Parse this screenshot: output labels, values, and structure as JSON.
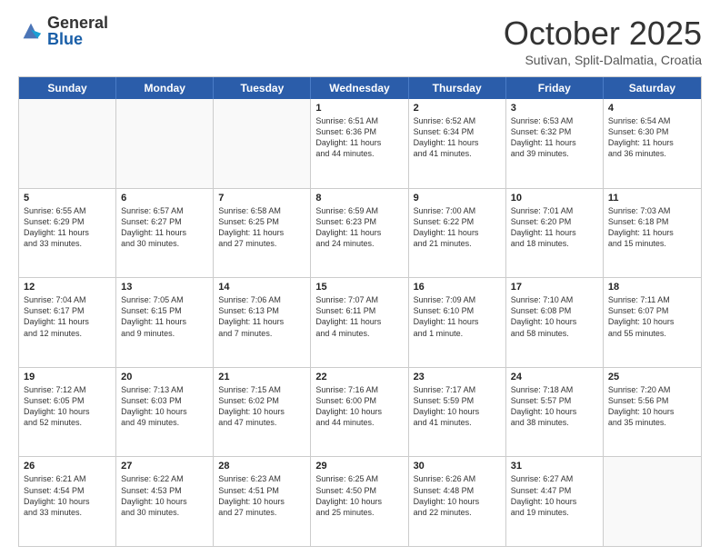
{
  "header": {
    "logo_general": "General",
    "logo_blue": "Blue",
    "month_title": "October 2025",
    "subtitle": "Sutivan, Split-Dalmatia, Croatia"
  },
  "weekdays": [
    "Sunday",
    "Monday",
    "Tuesday",
    "Wednesday",
    "Thursday",
    "Friday",
    "Saturday"
  ],
  "rows": [
    [
      {
        "day": "",
        "info": ""
      },
      {
        "day": "",
        "info": ""
      },
      {
        "day": "",
        "info": ""
      },
      {
        "day": "1",
        "info": "Sunrise: 6:51 AM\nSunset: 6:36 PM\nDaylight: 11 hours\nand 44 minutes."
      },
      {
        "day": "2",
        "info": "Sunrise: 6:52 AM\nSunset: 6:34 PM\nDaylight: 11 hours\nand 41 minutes."
      },
      {
        "day": "3",
        "info": "Sunrise: 6:53 AM\nSunset: 6:32 PM\nDaylight: 11 hours\nand 39 minutes."
      },
      {
        "day": "4",
        "info": "Sunrise: 6:54 AM\nSunset: 6:30 PM\nDaylight: 11 hours\nand 36 minutes."
      }
    ],
    [
      {
        "day": "5",
        "info": "Sunrise: 6:55 AM\nSunset: 6:29 PM\nDaylight: 11 hours\nand 33 minutes."
      },
      {
        "day": "6",
        "info": "Sunrise: 6:57 AM\nSunset: 6:27 PM\nDaylight: 11 hours\nand 30 minutes."
      },
      {
        "day": "7",
        "info": "Sunrise: 6:58 AM\nSunset: 6:25 PM\nDaylight: 11 hours\nand 27 minutes."
      },
      {
        "day": "8",
        "info": "Sunrise: 6:59 AM\nSunset: 6:23 PM\nDaylight: 11 hours\nand 24 minutes."
      },
      {
        "day": "9",
        "info": "Sunrise: 7:00 AM\nSunset: 6:22 PM\nDaylight: 11 hours\nand 21 minutes."
      },
      {
        "day": "10",
        "info": "Sunrise: 7:01 AM\nSunset: 6:20 PM\nDaylight: 11 hours\nand 18 minutes."
      },
      {
        "day": "11",
        "info": "Sunrise: 7:03 AM\nSunset: 6:18 PM\nDaylight: 11 hours\nand 15 minutes."
      }
    ],
    [
      {
        "day": "12",
        "info": "Sunrise: 7:04 AM\nSunset: 6:17 PM\nDaylight: 11 hours\nand 12 minutes."
      },
      {
        "day": "13",
        "info": "Sunrise: 7:05 AM\nSunset: 6:15 PM\nDaylight: 11 hours\nand 9 minutes."
      },
      {
        "day": "14",
        "info": "Sunrise: 7:06 AM\nSunset: 6:13 PM\nDaylight: 11 hours\nand 7 minutes."
      },
      {
        "day": "15",
        "info": "Sunrise: 7:07 AM\nSunset: 6:11 PM\nDaylight: 11 hours\nand 4 minutes."
      },
      {
        "day": "16",
        "info": "Sunrise: 7:09 AM\nSunset: 6:10 PM\nDaylight: 11 hours\nand 1 minute."
      },
      {
        "day": "17",
        "info": "Sunrise: 7:10 AM\nSunset: 6:08 PM\nDaylight: 10 hours\nand 58 minutes."
      },
      {
        "day": "18",
        "info": "Sunrise: 7:11 AM\nSunset: 6:07 PM\nDaylight: 10 hours\nand 55 minutes."
      }
    ],
    [
      {
        "day": "19",
        "info": "Sunrise: 7:12 AM\nSunset: 6:05 PM\nDaylight: 10 hours\nand 52 minutes."
      },
      {
        "day": "20",
        "info": "Sunrise: 7:13 AM\nSunset: 6:03 PM\nDaylight: 10 hours\nand 49 minutes."
      },
      {
        "day": "21",
        "info": "Sunrise: 7:15 AM\nSunset: 6:02 PM\nDaylight: 10 hours\nand 47 minutes."
      },
      {
        "day": "22",
        "info": "Sunrise: 7:16 AM\nSunset: 6:00 PM\nDaylight: 10 hours\nand 44 minutes."
      },
      {
        "day": "23",
        "info": "Sunrise: 7:17 AM\nSunset: 5:59 PM\nDaylight: 10 hours\nand 41 minutes."
      },
      {
        "day": "24",
        "info": "Sunrise: 7:18 AM\nSunset: 5:57 PM\nDaylight: 10 hours\nand 38 minutes."
      },
      {
        "day": "25",
        "info": "Sunrise: 7:20 AM\nSunset: 5:56 PM\nDaylight: 10 hours\nand 35 minutes."
      }
    ],
    [
      {
        "day": "26",
        "info": "Sunrise: 6:21 AM\nSunset: 4:54 PM\nDaylight: 10 hours\nand 33 minutes."
      },
      {
        "day": "27",
        "info": "Sunrise: 6:22 AM\nSunset: 4:53 PM\nDaylight: 10 hours\nand 30 minutes."
      },
      {
        "day": "28",
        "info": "Sunrise: 6:23 AM\nSunset: 4:51 PM\nDaylight: 10 hours\nand 27 minutes."
      },
      {
        "day": "29",
        "info": "Sunrise: 6:25 AM\nSunset: 4:50 PM\nDaylight: 10 hours\nand 25 minutes."
      },
      {
        "day": "30",
        "info": "Sunrise: 6:26 AM\nSunset: 4:48 PM\nDaylight: 10 hours\nand 22 minutes."
      },
      {
        "day": "31",
        "info": "Sunrise: 6:27 AM\nSunset: 4:47 PM\nDaylight: 10 hours\nand 19 minutes."
      },
      {
        "day": "",
        "info": ""
      }
    ]
  ]
}
